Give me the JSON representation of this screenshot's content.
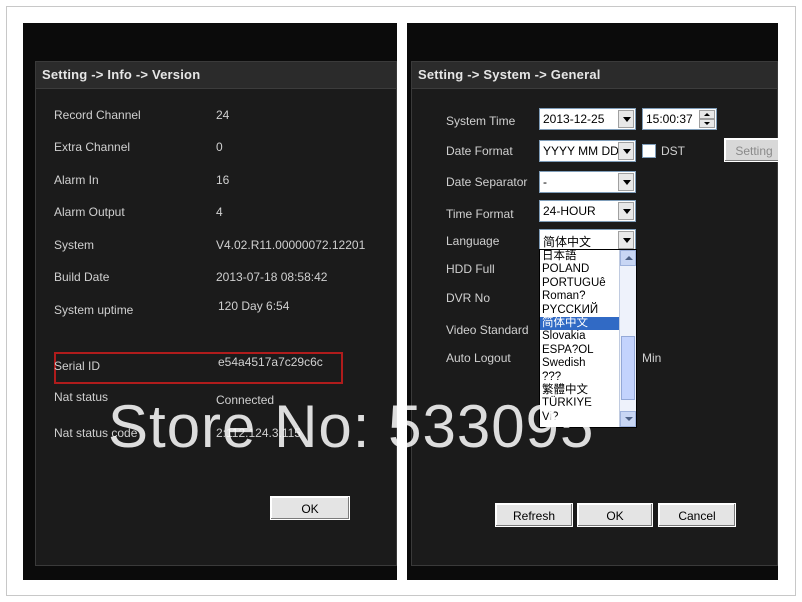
{
  "left_dialog": {
    "title": "Setting -> Info -> Version",
    "rows": [
      {
        "label": "Record Channel",
        "value": "24"
      },
      {
        "label": "Extra Channel",
        "value": "0"
      },
      {
        "label": "Alarm In",
        "value": "16"
      },
      {
        "label": "Alarm Output",
        "value": "4"
      },
      {
        "label": "System",
        "value": "V4.02.R11.00000072.12201"
      },
      {
        "label": "Build Date",
        "value": "2013-07-18 08:58:42"
      },
      {
        "label": "System uptime",
        "value": "120 Day 6:54"
      },
      {
        "label": "Serial ID",
        "value": "e54a4517a7c29c6c"
      },
      {
        "label": "Nat status",
        "value": "Connected"
      },
      {
        "label": "Nat status code",
        "value": "2:112.124.3.115"
      }
    ],
    "ok_label": "OK"
  },
  "right_dialog": {
    "title": "Setting -> System -> General",
    "system_time_label": "System Time",
    "date_value": "2013-12-25",
    "time_value": "15:00:37",
    "date_format_label": "Date Format",
    "date_format_value": "YYYY MM DD",
    "dst_label": "DST",
    "setting_label": "Setting",
    "date_separator_label": "Date Separator",
    "date_separator_value": "-",
    "time_format_label": "Time Format",
    "time_format_value": "24-HOUR",
    "language_label": "Language",
    "language_value": "简体中文",
    "hdd_full_label": "HDD Full",
    "dvr_no_label": "DVR No",
    "video_standard_label": "Video Standard",
    "auto_logout_label": "Auto Logout",
    "min_label": "Min",
    "language_options": [
      "日本語",
      "POLAND",
      "PORTUGUê",
      "Roman?",
      "PYCCKИЙ",
      "简体中文",
      "Slovakia",
      "ESPA?OL",
      "Swedish",
      "???",
      "繁體中文",
      "TÜRKIYE",
      "Vi?"
    ],
    "selected_language_index": 5,
    "refresh_label": "Refresh",
    "ok_label": "OK",
    "cancel_label": "Cancel"
  },
  "watermark": "Store No: 533095"
}
